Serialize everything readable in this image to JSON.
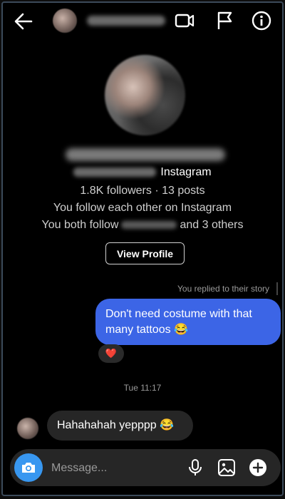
{
  "header": {
    "back_icon": "arrow-left-icon",
    "actions": [
      "video-call-icon",
      "flag-icon",
      "info-icon"
    ]
  },
  "profile": {
    "platform": "Instagram",
    "stats": "1.8K followers · 13 posts",
    "mutual": "You follow each other on Instagram",
    "both_follow_prefix": "You both follow",
    "both_follow_suffix": "and 3 others",
    "view_profile_label": "View Profile"
  },
  "messages": {
    "reply_note": "You replied to their story",
    "sent_text": "Don't need costume with that many tattoos 😂",
    "reaction": "❤️",
    "timestamp": "Tue 11:17",
    "received_text": "Hahahahah yepppp 😂"
  },
  "composer": {
    "placeholder": "Message...",
    "camera_icon": "camera-icon",
    "icons": [
      "microphone-icon",
      "gallery-icon",
      "plus-icon"
    ]
  },
  "colors": {
    "background": "#000000",
    "sent_bubble": "#3c65e6",
    "received_bubble": "#262626",
    "camera_button": "#3897f0"
  }
}
